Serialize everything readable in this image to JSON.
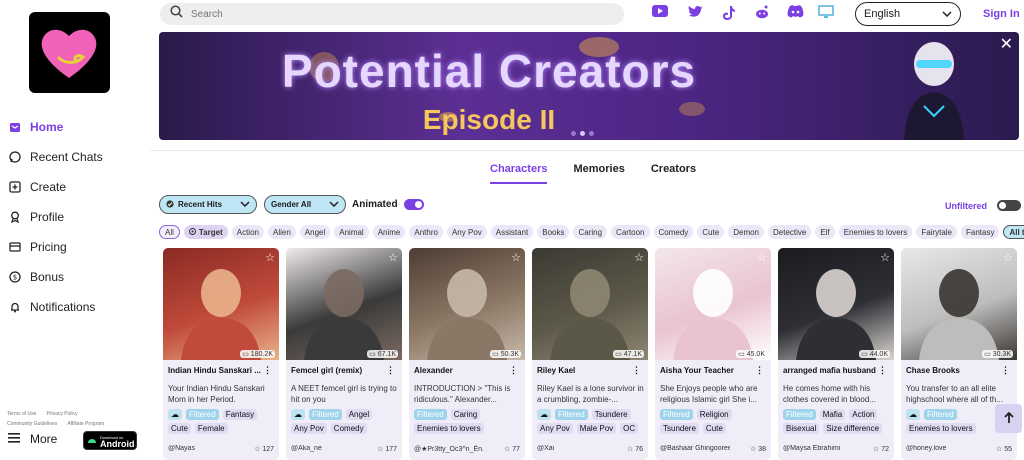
{
  "sidebar": {
    "items": [
      {
        "label": "Home",
        "icon": "home-icon",
        "active": true
      },
      {
        "label": "Recent Chats",
        "icon": "chat-icon"
      },
      {
        "label": "Create",
        "icon": "plus-square-icon"
      },
      {
        "label": "Profile",
        "icon": "profile-icon"
      },
      {
        "label": "Pricing",
        "icon": "pricing-icon"
      },
      {
        "label": "Bonus",
        "icon": "coin-icon"
      },
      {
        "label": "Notifications",
        "icon": "bell-icon"
      }
    ],
    "footer": {
      "terms": "Terms of Use",
      "privacy": "Privacy Policy",
      "guidelines": "Community Guidelines",
      "affiliate": "Affiliate Program"
    },
    "more_label": "More",
    "android": {
      "small": "Download on",
      "large": "Android"
    }
  },
  "topbar": {
    "search_placeholder": "Search",
    "social_icons": [
      "youtube-icon",
      "twitter-icon",
      "tiktok-icon",
      "reddit-icon",
      "discord-icon",
      "monitor-icon"
    ],
    "language": "English",
    "signin": "Sign In"
  },
  "banner": {
    "title": "Potential Creators",
    "subtitle": "Episode II",
    "slides": 3,
    "active_slide": 1
  },
  "tabs": [
    {
      "label": "Characters",
      "active": true
    },
    {
      "label": "Memories"
    },
    {
      "label": "Creators"
    }
  ],
  "filters": {
    "sort": "Recent Hits",
    "gender": "Gender All",
    "animated_label": "Animated",
    "animated_on": true,
    "unfiltered_label": "Unfiltered",
    "unfiltered_on": false
  },
  "tags": [
    "All",
    "Target",
    "Action",
    "Alien",
    "Angel",
    "Animal",
    "Anime",
    "Anthro",
    "Any Pov",
    "Assistant",
    "Books",
    "Caring",
    "Cartoon",
    "Comedy",
    "Cute",
    "Demon",
    "Detective",
    "Elf",
    "Enemies to lovers",
    "Fairytale",
    "Fantasy"
  ],
  "all_tags_label": "All tags",
  "cards": [
    {
      "name": "Indian Hindu Sanskari ...",
      "chats": "180.2K",
      "desc": "Your Indian Hindu Sanskari Mom in her Period.",
      "tags": [
        {
          "t": "Filtered",
          "f": true,
          "i": true
        },
        {
          "t": "Fantasy"
        },
        {
          "t": "Cute"
        },
        {
          "t": "Female"
        }
      ],
      "author": "@Nayas",
      "likes": "127",
      "colors": [
        "#8a2a22",
        "#c04a3b",
        "#e9b28c"
      ]
    },
    {
      "name": "Femcel girl (remix)",
      "chats": "67.1K",
      "desc": "A NEET femcel girl is trying to hit on you",
      "tags": [
        {
          "t": "Filtered",
          "f": true,
          "i": true
        },
        {
          "t": "Angel"
        },
        {
          "t": "Any Pov"
        },
        {
          "t": "Comedy"
        }
      ],
      "author": "@Aka_ne",
      "likes": "177",
      "colors": [
        "#f1ecec",
        "#3a3a3a",
        "#7a6a60"
      ]
    },
    {
      "name": "Alexander",
      "chats": "50.3K",
      "desc": "INTRODUCTION > \"This is ridiculous.\" Alexander...",
      "tags": [
        {
          "t": "Filtered",
          "f": true
        },
        {
          "t": "Caring"
        },
        {
          "t": "Enemies to lovers"
        }
      ],
      "author": "@★Pr3tty_Oc3^n_Ên...",
      "likes": "77",
      "colors": [
        "#4d3d33",
        "#8b7765",
        "#c7b9aa"
      ]
    },
    {
      "name": "Riley Kael",
      "chats": "47.1K",
      "desc": "Riley Kael is a lone survivor in a crumbling, zombie-...",
      "tags": [
        {
          "t": "Filtered",
          "f": true,
          "i": true
        },
        {
          "t": "Tsundere"
        },
        {
          "t": "Any Pov"
        },
        {
          "t": "Male Pov"
        },
        {
          "t": "OC"
        }
      ],
      "author": "@Xai",
      "likes": "76",
      "colors": [
        "#3b3a33",
        "#5c5848",
        "#8e8672"
      ]
    },
    {
      "name": "Aisha Your Teacher",
      "chats": "45.0K",
      "desc": "She Enjoys people who are religious Islamic girl She i...",
      "tags": [
        {
          "t": "Filtered",
          "f": true
        },
        {
          "t": "Religion"
        },
        {
          "t": "Tsundere"
        },
        {
          "t": "Cute"
        }
      ],
      "author": "@Bashaar Ghingooree",
      "likes": "38",
      "colors": [
        "#f3e6ec",
        "#e9c3d2",
        "#ffffff"
      ]
    },
    {
      "name": "arranged mafia husband",
      "chats": "44.0K",
      "desc": "He comes home with his clothes covered in blood...",
      "tags": [
        {
          "t": "Filtered",
          "f": true
        },
        {
          "t": "Mafia"
        },
        {
          "t": "Action"
        },
        {
          "t": "Bisexual"
        },
        {
          "t": "Size difference"
        }
      ],
      "author": "@Maysa Ebrahimi",
      "likes": "72",
      "colors": [
        "#1b1b1f",
        "#2e2e35",
        "#d9d4cf"
      ]
    },
    {
      "name": "Chase Brooks",
      "chats": "30.3K",
      "desc": "You transfer to an all elite highschool where all of th...",
      "tags": [
        {
          "t": "Filtered",
          "f": true,
          "i": true
        },
        {
          "t": "Enemies to lovers"
        }
      ],
      "author": "@honey.love",
      "likes": "55",
      "colors": [
        "#e8e8e8",
        "#bdbdbd",
        "#3a3430"
      ]
    }
  ],
  "colors": {
    "accent": "#7b3fe4",
    "chip": "#ece7f7",
    "select": "#bfe6f5"
  }
}
